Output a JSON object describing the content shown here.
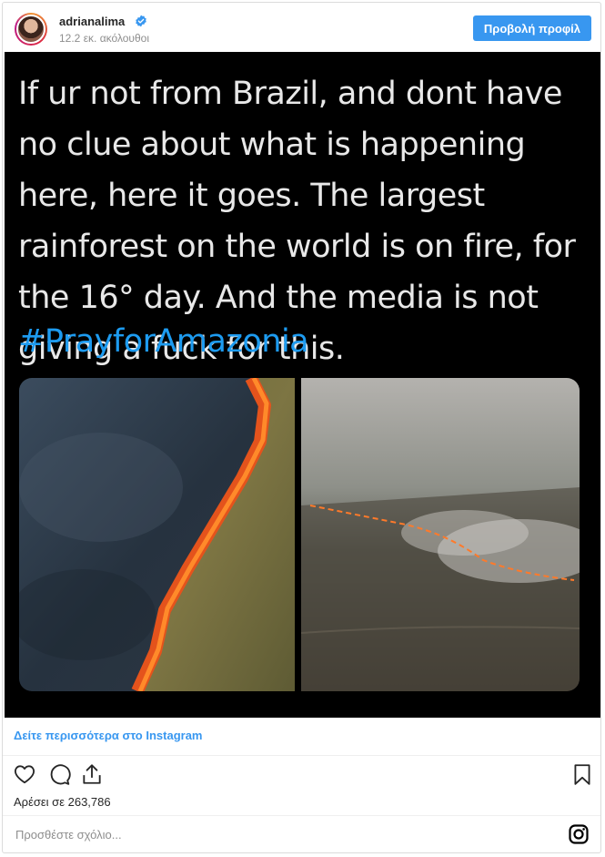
{
  "header": {
    "username": "adrianalima",
    "followers": "12.2 εκ. ακόλουθοι",
    "profile_button": "Προβολή προφίλ"
  },
  "post": {
    "tweet_text": "If ur not from Brazil, and dont have no clue about what is happening here, here it goes. The largest rainforest on the world is on fire, for the 16° day. And the media is not giving a fuck for this.",
    "hashtag": "#PrayforAmazonia"
  },
  "footer": {
    "more_link": "Δείτε περισσότερα στο Instagram",
    "likes": "Αρέσει σε 263,786",
    "comment_placeholder": "Προσθέστε σχόλιο..."
  },
  "icons": {
    "verified": "verified-badge-icon",
    "like": "heart-icon",
    "comment": "comment-bubble-icon",
    "share": "share-icon",
    "save": "bookmark-icon",
    "instagram": "instagram-logo-icon"
  },
  "colors": {
    "accent": "#3897f0",
    "hashtag": "#1d9bf0",
    "media_background": "#000000"
  }
}
